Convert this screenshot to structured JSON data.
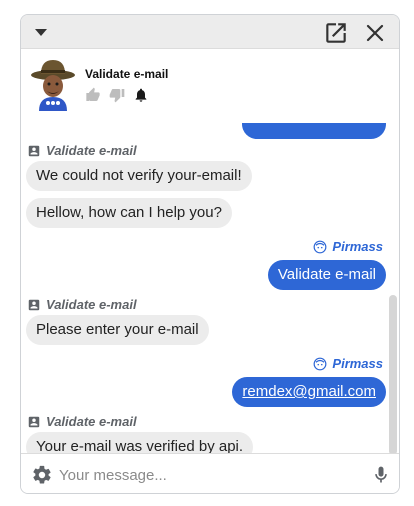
{
  "header": {
    "agent_name": "Validate e-mail"
  },
  "messages": [
    {
      "sender": "Validate e-mail",
      "text": "We could not verify your-email!"
    },
    {
      "text": "Hellow, how can I help you?"
    },
    {
      "sender": "Pirmass",
      "text": "Validate e-mail"
    },
    {
      "sender": "Validate e-mail",
      "text": "Please enter your e-mail"
    },
    {
      "sender": "Pirmass",
      "text": "remdex@gmail.com"
    },
    {
      "sender": "Validate e-mail",
      "text": "Your e-mail was verified by api."
    }
  ],
  "composer": {
    "placeholder": "Your message..."
  },
  "colors": {
    "accent": "#2e67d6",
    "bubble_in": "#ececec",
    "topbar": "#ececec"
  }
}
